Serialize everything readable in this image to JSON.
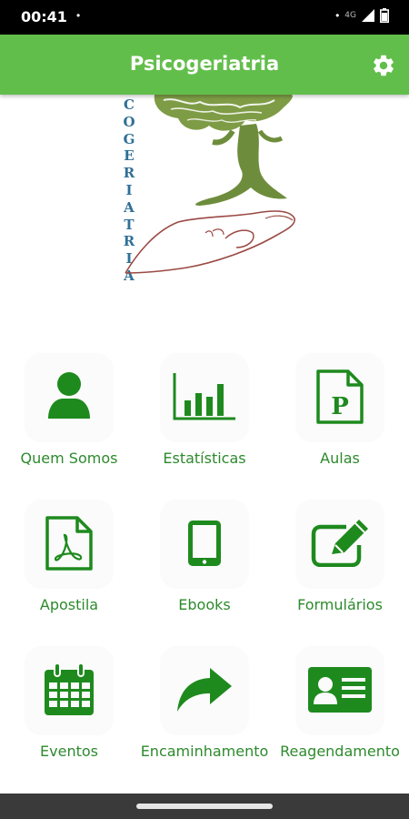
{
  "status_bar": {
    "time": "00:41",
    "dot_left": "•",
    "dot_right": "•",
    "network": "4G"
  },
  "app_bar": {
    "title": "Psicogeriatria",
    "settings_icon": "gear-icon",
    "color": "#62be4b"
  },
  "logo": {
    "letters": [
      "C",
      "O",
      "G",
      "E",
      "R",
      "I",
      "A",
      "T",
      "R",
      "I",
      "A"
    ],
    "letter_color": "#2f6f96",
    "tree_color": "#6e8d3c",
    "hand_color": "#9a4a44"
  },
  "menu": {
    "accent": "#1e8a1e",
    "items": [
      {
        "label": "Quem Somos",
        "icon": "user-icon"
      },
      {
        "label": "Estatísticas",
        "icon": "bar-chart-icon"
      },
      {
        "label": "Aulas",
        "icon": "powerpoint-file-icon"
      },
      {
        "label": "Apostila",
        "icon": "pdf-file-icon"
      },
      {
        "label": "Ebooks",
        "icon": "tablet-icon"
      },
      {
        "label": "Formulários",
        "icon": "edit-form-icon"
      },
      {
        "label": "Eventos",
        "icon": "calendar-icon"
      },
      {
        "label": "Encaminhamento",
        "icon": "share-arrow-icon"
      },
      {
        "label": "Reagendamento",
        "icon": "id-card-icon"
      }
    ]
  }
}
